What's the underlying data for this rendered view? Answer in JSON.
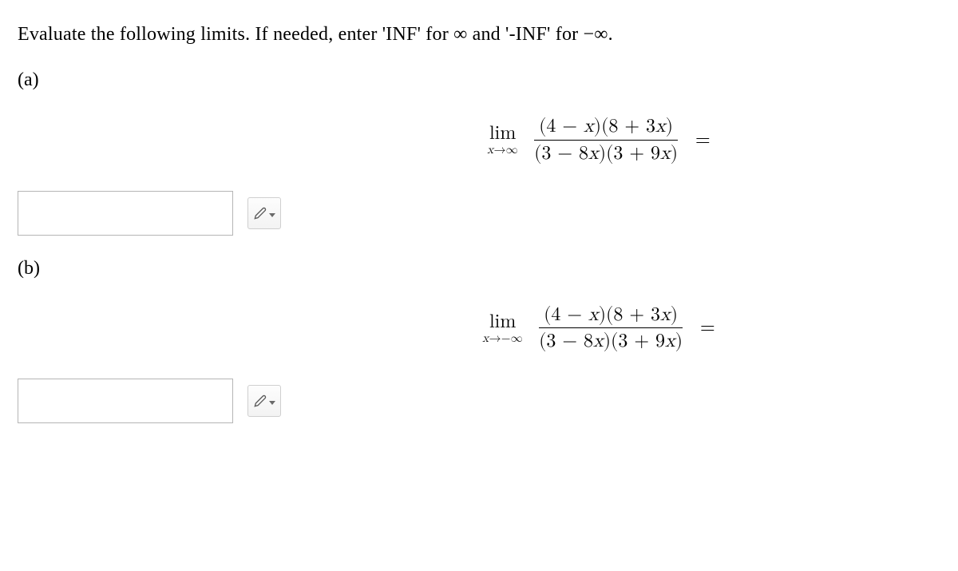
{
  "instructions": "Evaluate the following limits. If needed, enter 'INF' for ∞ and '-INF' for −∞.",
  "part_a": {
    "label": "(a)",
    "lim_text": "lim",
    "lim_sub_var": "x",
    "lim_sub_arrow": "→∞",
    "numerator": "(4 − x)(8 + 3x)",
    "denominator": "(3 − 8x)(3 + 9x)",
    "equals": "=",
    "answer": ""
  },
  "part_b": {
    "label": "(b)",
    "lim_text": "lim",
    "lim_sub_var": "x",
    "lim_sub_arrow": "→−∞",
    "numerator": "(4 − x)(8 + 3x)",
    "denominator": "(3 − 8x)(3 + 9x)",
    "equals": "=",
    "answer": ""
  }
}
